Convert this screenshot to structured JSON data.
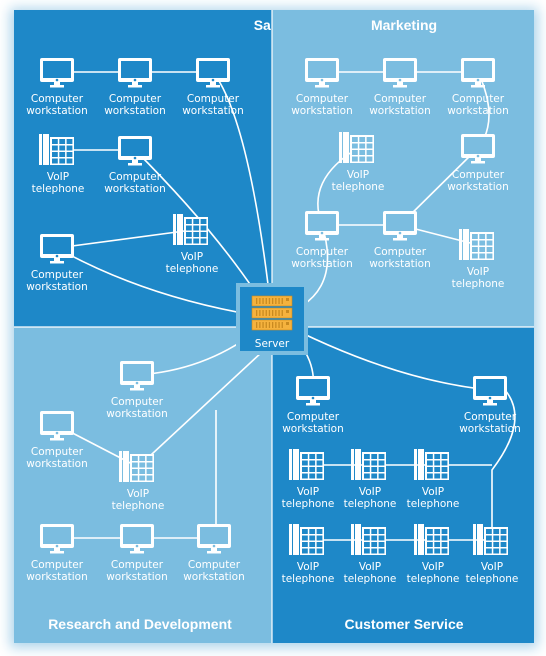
{
  "colors": {
    "dark_zone": "#1e88c8",
    "light_zone": "#7bbde0",
    "server_accent": "#f5b23e",
    "line": "#ffffff"
  },
  "zones": [
    {
      "id": "sales",
      "title": "Sales",
      "shade": "dark"
    },
    {
      "id": "marketing",
      "title": "Marketing",
      "shade": "light"
    },
    {
      "id": "rnd",
      "title": "Research and Development",
      "shade": "light"
    },
    {
      "id": "cs",
      "title": "Customer Service",
      "shade": "dark"
    }
  ],
  "server": {
    "label": "Server",
    "icon": "server-rack-icon"
  },
  "nodes": [
    {
      "id": "s1",
      "type": "computer",
      "label": [
        "Computer",
        "workstation"
      ]
    },
    {
      "id": "s2",
      "type": "computer",
      "label": [
        "Computer",
        "workstation"
      ]
    },
    {
      "id": "s3",
      "type": "computer",
      "label": [
        "Computer",
        "workstation"
      ]
    },
    {
      "id": "s4",
      "type": "phone",
      "label": [
        "VoIP",
        "telephone"
      ]
    },
    {
      "id": "s5",
      "type": "computer",
      "label": [
        "Computer",
        "workstation"
      ]
    },
    {
      "id": "s6",
      "type": "computer",
      "label": [
        "Computer",
        "workstation"
      ]
    },
    {
      "id": "s7",
      "type": "phone",
      "label": [
        "VoIP",
        "telephone"
      ]
    },
    {
      "id": "m1",
      "type": "computer",
      "label": [
        "Computer",
        "workstation"
      ]
    },
    {
      "id": "m2",
      "type": "computer",
      "label": [
        "Computer",
        "workstation"
      ]
    },
    {
      "id": "m3",
      "type": "computer",
      "label": [
        "Computer",
        "workstation"
      ]
    },
    {
      "id": "m4",
      "type": "phone",
      "label": [
        "VoIP",
        "telephone"
      ]
    },
    {
      "id": "m5",
      "type": "computer",
      "label": [
        "Computer",
        "workstation"
      ]
    },
    {
      "id": "m6",
      "type": "computer",
      "label": [
        "Computer",
        "workstation"
      ]
    },
    {
      "id": "m7",
      "type": "computer",
      "label": [
        "Computer",
        "workstation"
      ]
    },
    {
      "id": "m8",
      "type": "phone",
      "label": [
        "VoIP",
        "telephone"
      ]
    },
    {
      "id": "r1",
      "type": "computer",
      "label": [
        "Computer",
        "workstation"
      ]
    },
    {
      "id": "r2",
      "type": "computer",
      "label": [
        "Computer",
        "workstation"
      ]
    },
    {
      "id": "r3",
      "type": "phone",
      "label": [
        "VoIP",
        "telephone"
      ]
    },
    {
      "id": "r4",
      "type": "computer",
      "label": [
        "Computer",
        "workstation"
      ]
    },
    {
      "id": "r5",
      "type": "computer",
      "label": [
        "Computer",
        "workstation"
      ]
    },
    {
      "id": "r6",
      "type": "computer",
      "label": [
        "Computer",
        "workstation"
      ]
    },
    {
      "id": "c1",
      "type": "computer",
      "label": [
        "Computer",
        "workstation"
      ]
    },
    {
      "id": "c2",
      "type": "computer",
      "label": [
        "Computer",
        "workstation"
      ]
    },
    {
      "id": "c3",
      "type": "phone",
      "label": [
        "VoIP",
        "telephone"
      ]
    },
    {
      "id": "c4",
      "type": "phone",
      "label": [
        "VoIP",
        "telephone"
      ]
    },
    {
      "id": "c5",
      "type": "phone",
      "label": [
        "VoIP",
        "telephone"
      ]
    },
    {
      "id": "c6",
      "type": "phone",
      "label": [
        "VoIP",
        "telephone"
      ]
    },
    {
      "id": "c7",
      "type": "phone",
      "label": [
        "VoIP",
        "telephone"
      ]
    },
    {
      "id": "c8",
      "type": "phone",
      "label": [
        "VoIP",
        "telephone"
      ]
    },
    {
      "id": "c9",
      "type": "phone",
      "label": [
        "VoIP",
        "telephone"
      ]
    }
  ],
  "links": [
    [
      "s1",
      "s2"
    ],
    [
      "s2",
      "s3"
    ],
    [
      "s3",
      "server"
    ],
    [
      "s4",
      "s5"
    ],
    [
      "s5",
      "server"
    ],
    [
      "s6",
      "s7"
    ],
    [
      "s6",
      "server"
    ],
    [
      "m1",
      "m2"
    ],
    [
      "m2",
      "m3"
    ],
    [
      "m3",
      "m5"
    ],
    [
      "m5",
      "m7"
    ],
    [
      "m6",
      "m7"
    ],
    [
      "m7",
      "m8"
    ],
    [
      "m4",
      "m6"
    ],
    [
      "m6",
      "server"
    ],
    [
      "r1",
      "server"
    ],
    [
      "r2",
      "r3"
    ],
    [
      "r3",
      "server"
    ],
    [
      "r4",
      "r5"
    ],
    [
      "r5",
      "r6"
    ],
    [
      "r6",
      "server"
    ],
    [
      "c1",
      "server"
    ],
    [
      "c2",
      "server"
    ],
    [
      "c3",
      "c4"
    ],
    [
      "c4",
      "c5"
    ],
    [
      "c5",
      "c9"
    ],
    [
      "c6",
      "c7"
    ],
    [
      "c7",
      "c8"
    ],
    [
      "c8",
      "c9"
    ],
    [
      "c2",
      "c9"
    ]
  ]
}
